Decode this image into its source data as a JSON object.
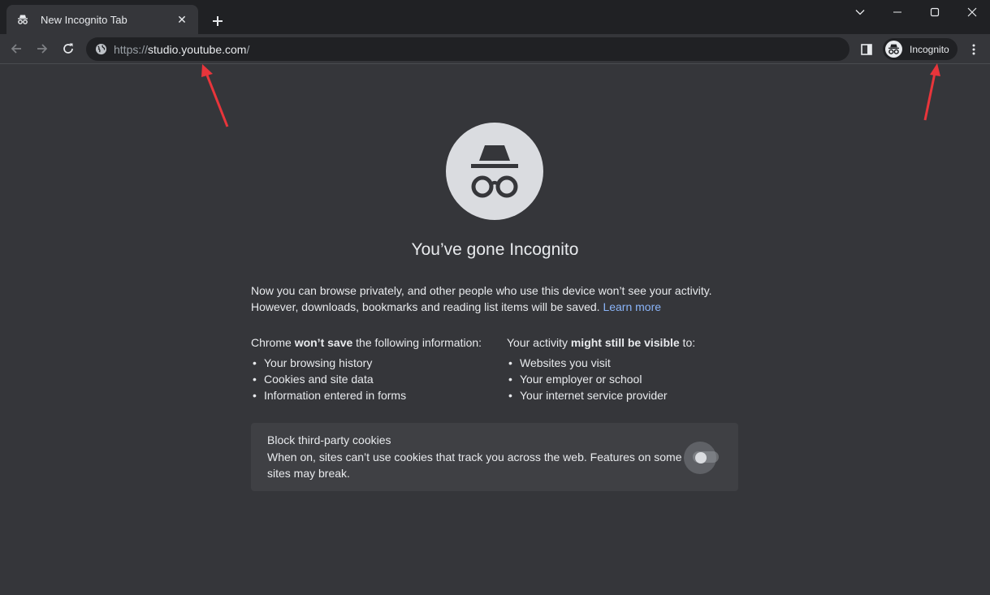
{
  "tab": {
    "title": "New Incognito Tab",
    "close_glyph": "✕"
  },
  "omnibox": {
    "url_prefix": "https://",
    "url_host": "studio.youtube.com",
    "url_suffix": "/"
  },
  "profile": {
    "label": "Incognito"
  },
  "content": {
    "heading": "You’ve gone Incognito",
    "intro_line1": "Now you can browse privately, and other people who use this device won’t see your activity.",
    "intro_line2": "However, downloads, bookmarks and reading list items will be saved.",
    "learn_more": "Learn more",
    "left_head_pre": "Chrome ",
    "left_head_bold": "won’t save",
    "left_head_post": " the following information:",
    "left_items": [
      "Your browsing history",
      "Cookies and site data",
      "Information entered in forms"
    ],
    "right_head_pre": "Your activity ",
    "right_head_bold": "might still be visible",
    "right_head_post": " to:",
    "right_items": [
      "Websites you visit",
      "Your employer or school",
      "Your internet service provider"
    ]
  },
  "cookies": {
    "title": "Block third-party cookies",
    "description": "When on, sites can’t use cookies that track you across the web. Features on some sites may break.",
    "enabled": false
  },
  "colors": {
    "background": "#35363a",
    "tabstrip": "#202124",
    "link": "#8ab4f8",
    "annotation_arrow": "#e8353b"
  }
}
